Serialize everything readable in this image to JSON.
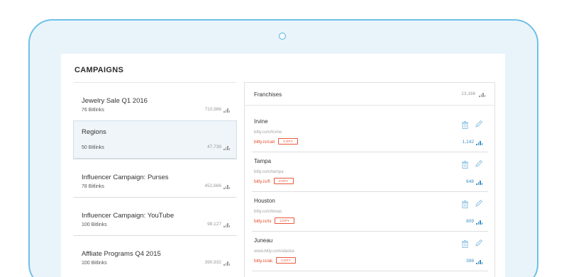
{
  "header": {
    "title": "CAMPAIGNS"
  },
  "campaigns": [
    {
      "name": "Jewelry Sale Q1 2016",
      "count": "76 Bitlinks",
      "clicks": "710,986",
      "selected": false
    },
    {
      "name": "Regions",
      "count": "50 Bitlinks",
      "clicks": "47,739",
      "selected": true
    },
    {
      "name": "Influencer Campaign: Purses",
      "count": "78 Bitlinks",
      "clicks": "452,666",
      "selected": false
    },
    {
      "name": "Influencer Campaign: YouTube",
      "count": "100 Bitlinks",
      "clicks": "98,127",
      "selected": false
    },
    {
      "name": "Affliate Programs Q4 2015",
      "count": "100 Bitlinks",
      "clicks": "390,932",
      "selected": false
    }
  ],
  "detail": {
    "title": "Franchises",
    "clicks": "13,166",
    "copy_label": "COPY",
    "links": [
      {
        "name": "Irvine",
        "long_url": "bitly.com/irvine",
        "short_url": "bitly.is/cali",
        "clicks": "1,142"
      },
      {
        "name": "Tampa",
        "long_url": "bitly.com/tampa",
        "short_url": "bitly.is/fl",
        "clicks": "648"
      },
      {
        "name": "Houston",
        "long_url": "bitly.com/texas",
        "short_url": "bitly.is/tx",
        "clicks": "809"
      },
      {
        "name": "Juneau",
        "long_url": "www.bitly.com/alaska",
        "short_url": "bitly.is/ak",
        "clicks": "398"
      }
    ]
  },
  "icons": {
    "delete": "trash-icon",
    "edit": "pencil-icon",
    "stats": "bar-chart-icon"
  },
  "colors": {
    "frame_border": "#6ec0e6",
    "frame_fill": "#e9f4fa",
    "short_link": "#e64e2e",
    "click_count": "#3a8fc4",
    "selected_row": "#eff5f9"
  }
}
